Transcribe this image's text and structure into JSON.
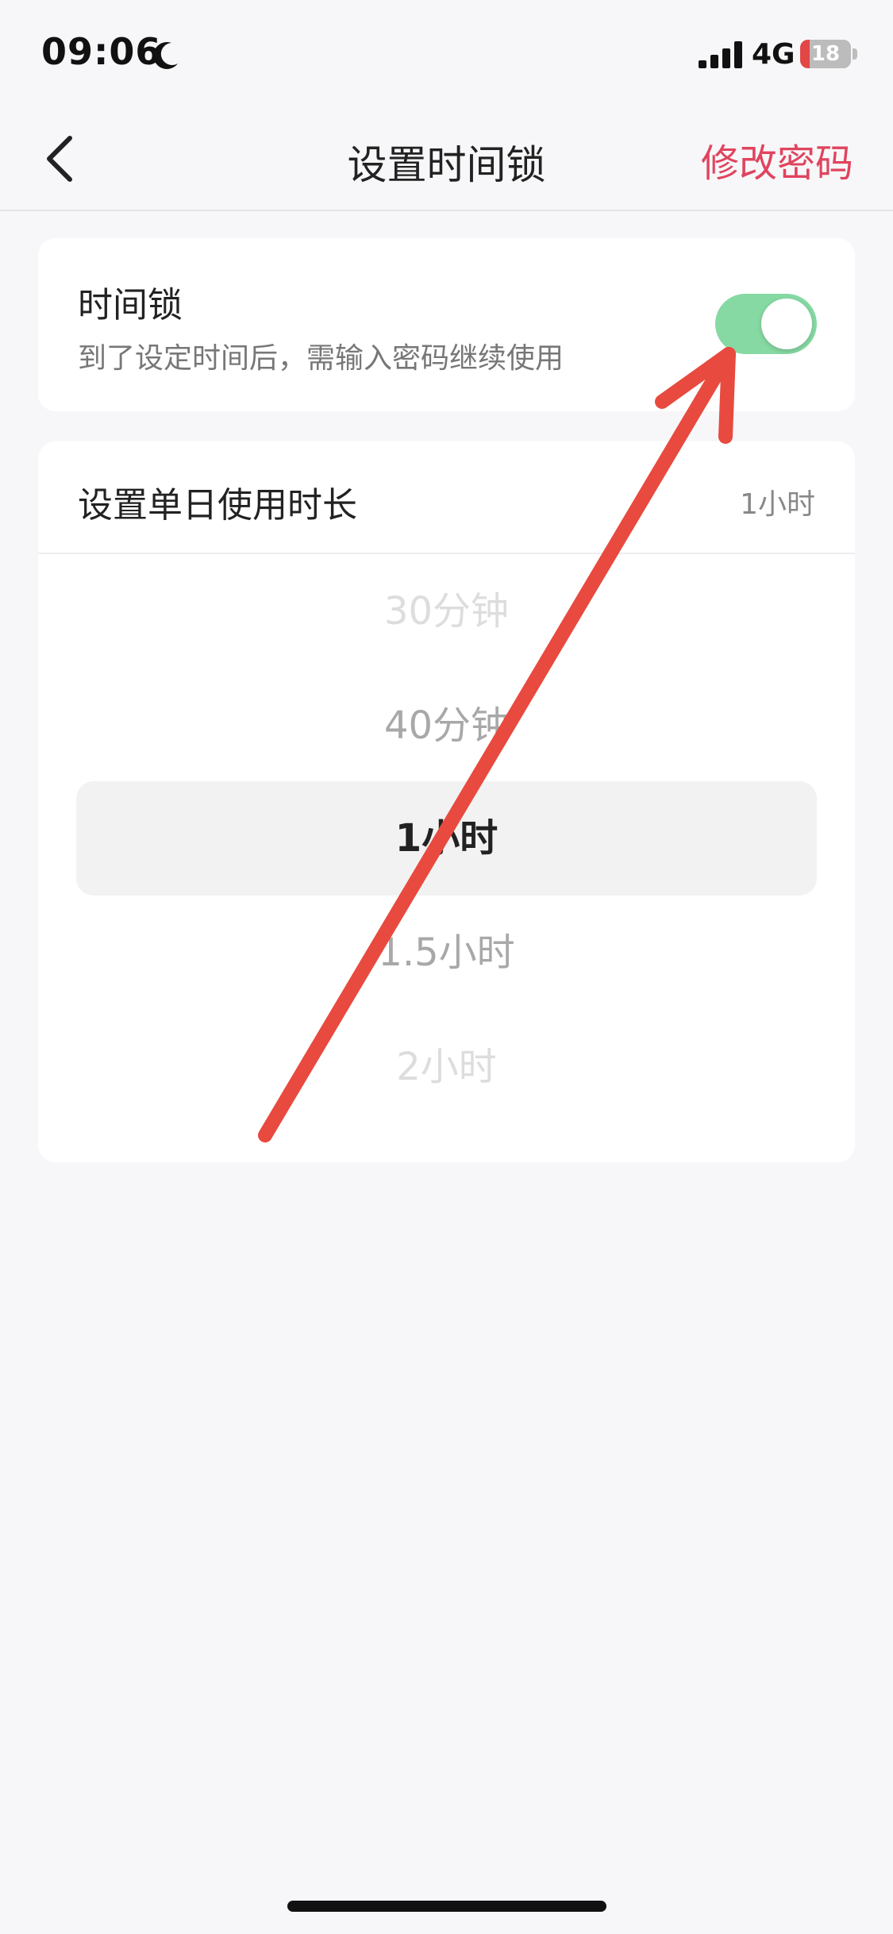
{
  "status_bar": {
    "time": "09:06",
    "network": "4G",
    "battery_level": "18",
    "battery_fraction": 0.18,
    "battery_color": "#e24646",
    "icons": [
      "moon-icon",
      "signal-icon",
      "battery-icon"
    ]
  },
  "nav": {
    "back_icon": "chevron-left-icon",
    "title": "设置时间锁",
    "action_label": "修改密码",
    "action_color": "#e0445e"
  },
  "time_lock": {
    "title": "时间锁",
    "description": "到了设定时间后，需输入密码继续使用",
    "enabled": true,
    "toggle_color": "#86d9a3"
  },
  "daily_duration": {
    "label": "设置单日使用时长",
    "current_value": "1小时",
    "options": [
      "30分钟",
      "40分钟",
      "1小时",
      "1.5小时",
      "2小时"
    ],
    "selected_index": 2
  },
  "annotation": {
    "color": "#e84a3f",
    "icon": "arrow-annotation-icon"
  }
}
